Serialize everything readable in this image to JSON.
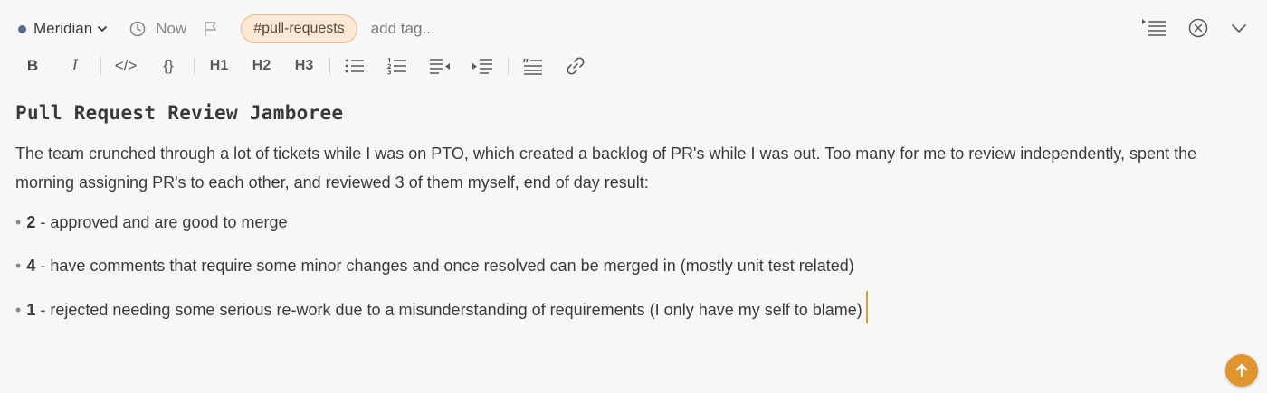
{
  "header": {
    "workspace": "Meridian",
    "time_label": "Now",
    "tag": "#pull-requests",
    "add_tag": "add tag..."
  },
  "toolbar": {
    "bold": "B",
    "italic": "I",
    "code": "</>",
    "code_block": "{}",
    "h1": "H1",
    "h2": "H2",
    "h3": "H3",
    "icons": [
      "bullet-list-icon",
      "numbered-list-icon",
      "outdent-icon",
      "indent-icon",
      "quote-icon",
      "link-icon"
    ]
  },
  "note": {
    "title": "Pull Request Review Jamboree",
    "paragraph": "The team crunched through a lot of tickets while I was on PTO, which created a backlog of PR's while I was out. Too many for me to review independently, spent the morning assigning PR's to each other, and reviewed 3 of them myself, end of day result:",
    "bullets": [
      {
        "count": "2",
        "text": " - approved and are good to merge"
      },
      {
        "count": "4",
        "text": " - have comments that require some minor changes and once resolved can be merged in (mostly unit test related)"
      },
      {
        "count": "1",
        "text": " - rejected needing some serious re-work due to a misunderstanding of requirements (I only have my self to blame)"
      }
    ]
  },
  "colors": {
    "accent": "#e0952f",
    "tag_bg": "#fbe9d6",
    "tag_border": "#e7b98a",
    "background": "#f7f7f8"
  }
}
